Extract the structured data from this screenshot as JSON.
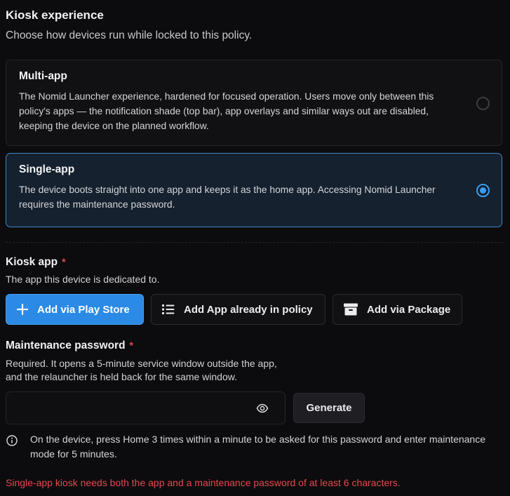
{
  "kiosk": {
    "title": "Kiosk experience",
    "subtitle": "Choose how devices run while locked to this policy.",
    "options": [
      {
        "title": "Multi-app",
        "description": "The Nomid Launcher experience, hardened for focused operation. Users move only between this policy's apps — the notification shade (top bar), app overlays and similar ways out are disabled, keeping the device on the planned workflow.",
        "selected": false
      },
      {
        "title": "Single-app",
        "description": "The device boots straight into one app and keeps it as the home app. Accessing Nomid Launcher requires the maintenance password.",
        "selected": true
      }
    ]
  },
  "kiosk_app": {
    "label": "Kiosk app",
    "required_mark": "*",
    "help": "The app this device is dedicated to.",
    "buttons": {
      "play_store": "Add via Play Store",
      "in_policy": "Add App already in policy",
      "package": "Add via Package"
    }
  },
  "maintenance": {
    "label": "Maintenance password",
    "required_mark": "*",
    "help_line1": "Required. It opens a 5-minute service window outside the app,",
    "help_line2": "and the relauncher is held back for the same window.",
    "password_value": "",
    "generate_label": "Generate",
    "info": "On the device, press Home 3 times within a minute to be asked for this password and enter maintenance mode for 5 minutes."
  },
  "error": "Single-app kiosk needs both the app and a maintenance password of at least 6 characters.",
  "colors": {
    "accent": "#2b8ae6",
    "selected_border": "#3f86c6",
    "error": "#e5484d",
    "background": "#0c0c0e"
  }
}
